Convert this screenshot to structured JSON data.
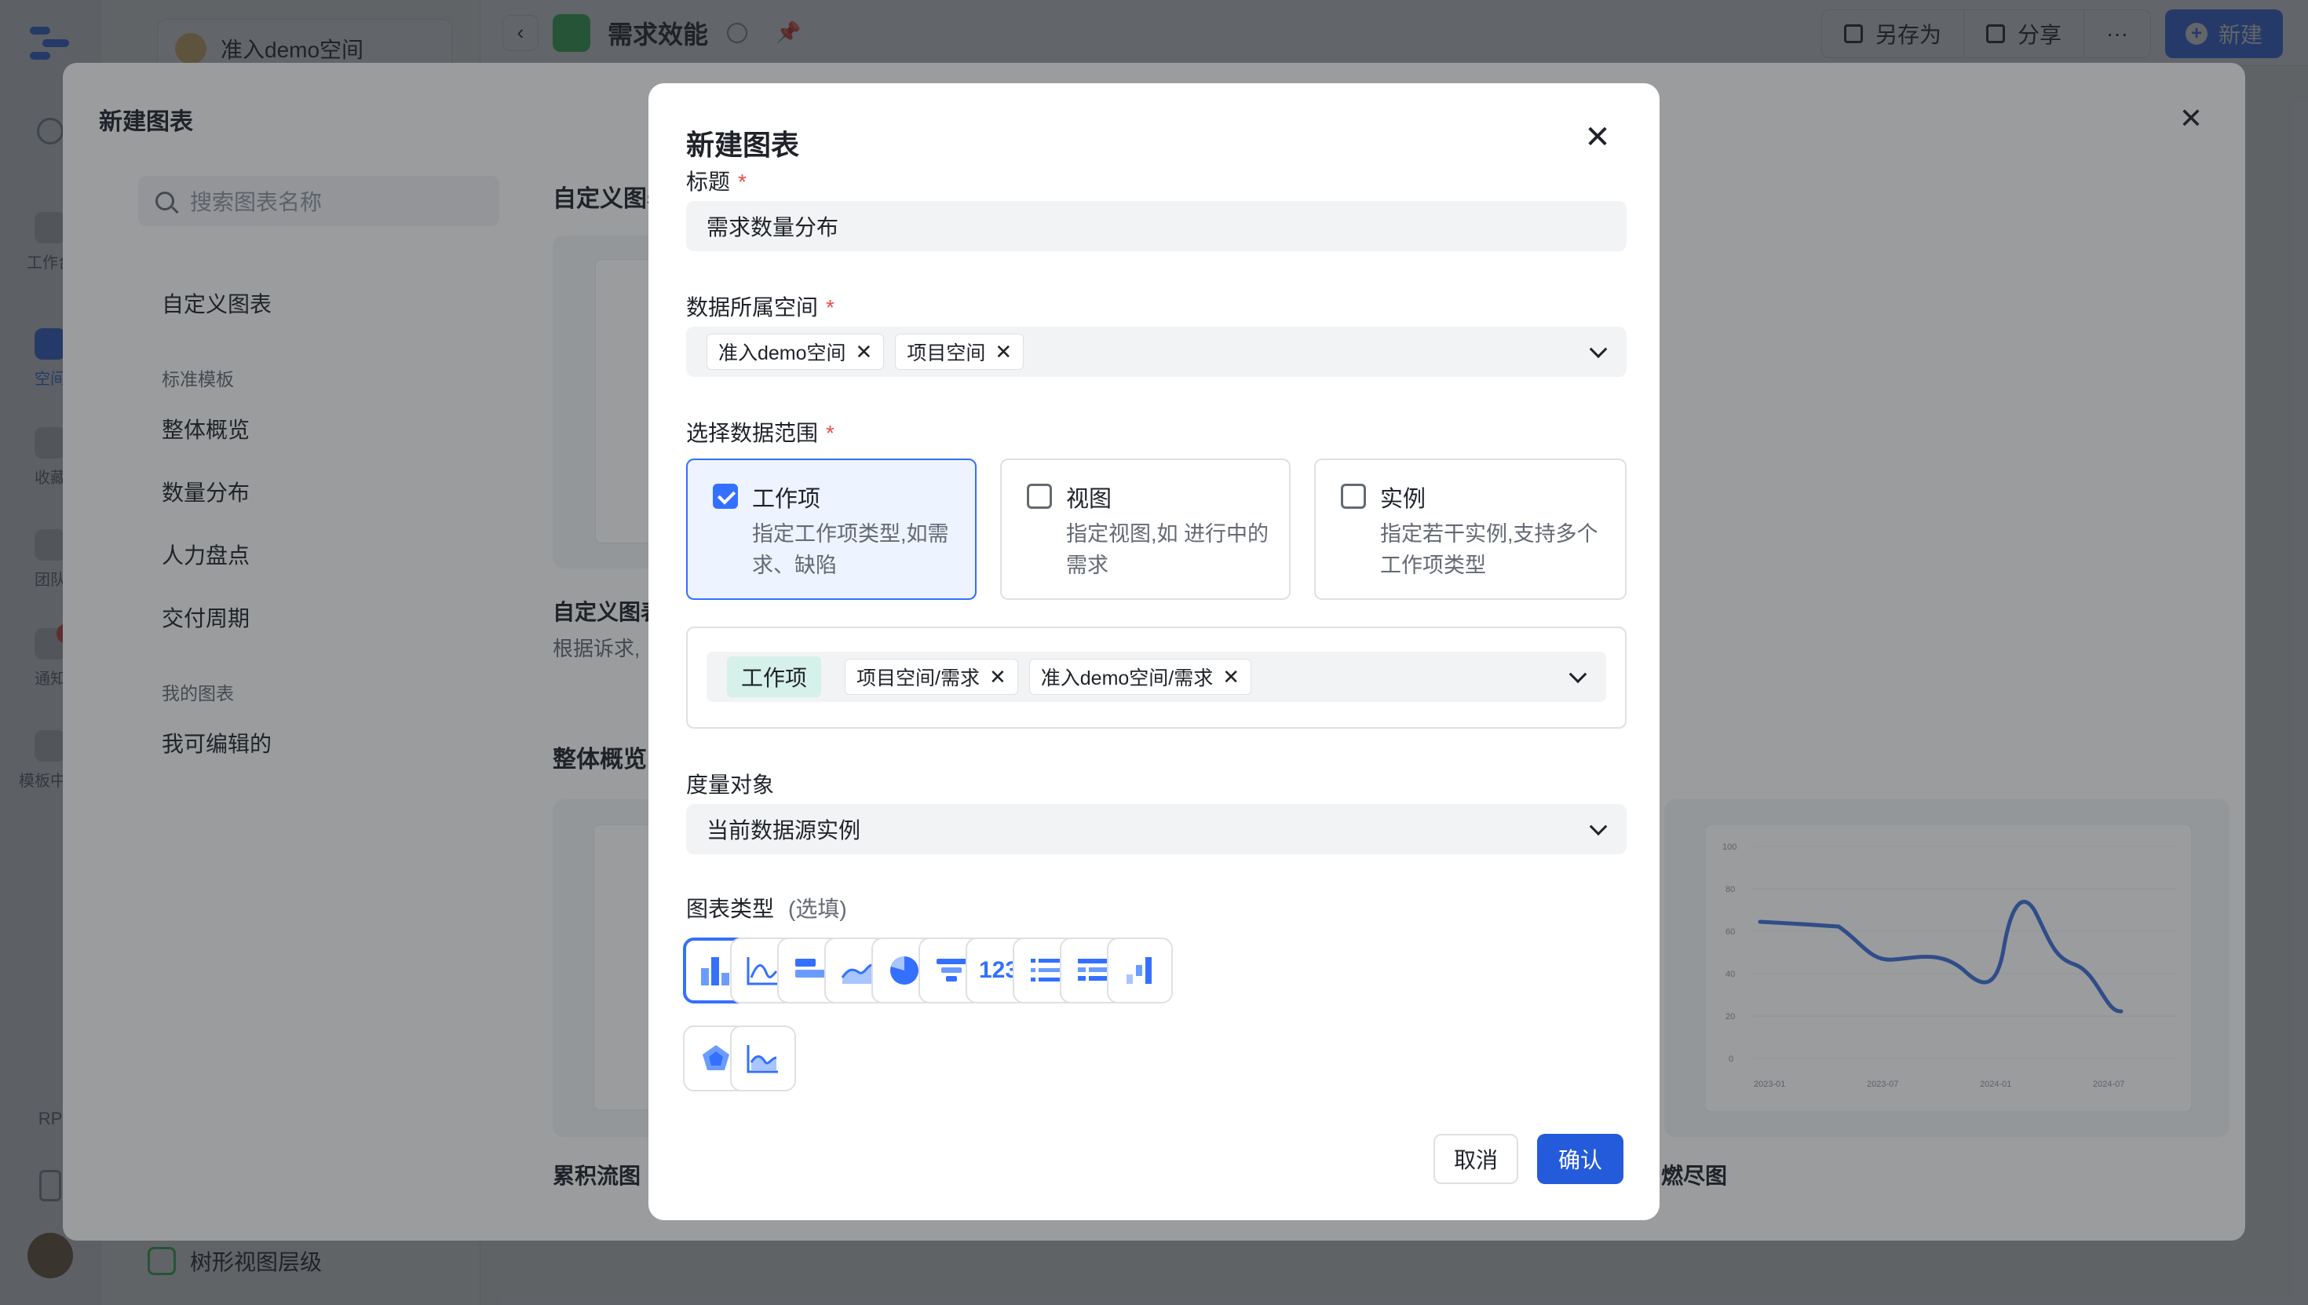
{
  "sidebar": {
    "space_name": "准入demo空间",
    "bottom_item": "树形视图层级",
    "rail": [
      "工作台",
      "空间",
      "收藏",
      "团队",
      "通知",
      "模板中心"
    ],
    "notify_badge": "9",
    "rp_label": "RP"
  },
  "topbar": {
    "title": "需求效能",
    "save_as": "另存为",
    "share": "分享",
    "more": "···",
    "new": "新建"
  },
  "panel": {
    "title": "新建图表",
    "search_placeholder": "搜索图表名称",
    "nav_custom": "自定义图表",
    "group_standard": "标准模板",
    "nav_overview": "整体概览",
    "nav_distribution": "数量分布",
    "nav_manpower": "人力盘点",
    "nav_cycle": "交付周期",
    "group_mine": "我的图表",
    "nav_editable": "我可编辑的",
    "section_custom": "自定义图表",
    "card_custom_label": "自定义图表",
    "card_custom_desc": "根据诉求,",
    "section_overview": "整体概览",
    "card_cfd_label": "累积流图",
    "card_burndown_label": "燃尽图",
    "chart_y_ticks": [
      "100",
      "80",
      "60",
      "40",
      "20",
      "0"
    ],
    "chart_x_ticks": [
      "2023-01",
      "2023-07",
      "2024-01",
      "2024-07"
    ]
  },
  "modal": {
    "title": "新建图表",
    "title_label": "标题",
    "title_value": "需求数量分布",
    "space_label": "数据所属空间",
    "space_tags": [
      "准入demo空间",
      "项目空间"
    ],
    "scope_label": "选择数据范围",
    "scopes": [
      {
        "title": "工作项",
        "desc": "指定工作项类型,如需求、缺陷"
      },
      {
        "title": "视图",
        "desc": "指定视图,如 进行中的需求"
      },
      {
        "title": "实例",
        "desc": "指定若干实例,支持多个工作项类型"
      }
    ],
    "workitem_type": "工作项",
    "workitem_tags": [
      "项目空间/需求",
      "准入demo空间/需求"
    ],
    "measure_label": "度量对象",
    "measure_value": "当前数据源实例",
    "charttype_label": "图表类型",
    "charttype_optional": "(选填)",
    "metric_icon_text": "123",
    "cancel": "取消",
    "confirm": "确认",
    "required_mark": "*"
  },
  "colors": {
    "primary": "#3370ff",
    "confirm": "#245bdb",
    "required": "#f54a45"
  }
}
